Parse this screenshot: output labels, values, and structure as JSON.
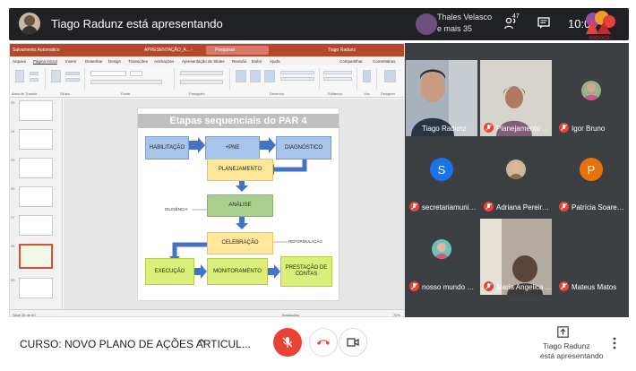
{
  "topbar": {
    "presenting_text": "Tiago Radunz está apresentando",
    "others_name": "Thales Velasco",
    "others_more": "e mais 35",
    "people_count": "47",
    "clock": "10:00",
    "logo_caption": "ARDOCE"
  },
  "ppt": {
    "autosave": "Salvamento Automático",
    "file_name": "APRESENTAÇÃO_A... -",
    "search": "Pesquisar",
    "user": "Tiago Radunz",
    "tabs": [
      "Arquivo",
      "Página Inicial",
      "Inserir",
      "Desenhar",
      "Design",
      "Transições",
      "Animações",
      "Apresentação de Slides",
      "Revisão",
      "Exibir",
      "Ajuda"
    ],
    "share": "Compartilhar",
    "comments": "Comentários",
    "groups": [
      "Área de Transfe...",
      "Slides",
      "Fonte",
      "Parágrafo",
      "Desenho",
      "Editando",
      "Voz",
      "Designer"
    ],
    "thumb_numbers": [
      "23",
      "24",
      "25",
      "26",
      "27",
      "28",
      "29"
    ],
    "status_left": "Slide 28 de 60",
    "status_notes": "Anotações",
    "status_zoom": "72%"
  },
  "slide": {
    "title": "Etapas sequenciais do PAR 4",
    "boxes": {
      "habilitacao": "HABILITAÇÃO",
      "pne": "+PNE",
      "diagnostico": "DIAGNÓSTICO",
      "planejamento": "PLANEJAMENTO",
      "analise": "ANÁLISE",
      "celebracao": "CELEBRAÇÃO",
      "execucao": "EXECUÇÃO",
      "monitoramento": "MONITORAMENTO",
      "prestacao": "PRESTAÇÃO DE CONTAS"
    },
    "labels": {
      "diligencia": "DILIGÊNCIA",
      "reformulacao": "REFORMULAÇÃO"
    }
  },
  "participants": [
    {
      "name": "Tiago Radunz",
      "muted": false
    },
    {
      "name": "Planejamento E...",
      "muted": true
    },
    {
      "name": "Igor Bruno",
      "muted": true
    },
    {
      "name": "secretariamunic...",
      "muted": true,
      "initial": "S",
      "color": "#1a73e8"
    },
    {
      "name": "Adriana Pereira ...",
      "muted": true
    },
    {
      "name": "Patrícia Soares ...",
      "muted": true,
      "initial": "P",
      "color": "#e8710a"
    },
    {
      "name": "nosso mundo M...",
      "muted": true
    },
    {
      "name": "Maria Angelica ...",
      "muted": true
    },
    {
      "name": "Mateus Matos",
      "muted": true
    }
  ],
  "bottombar": {
    "meeting_title": "CURSO: NOVO PLANO DE AÇÕES ARTICUL...",
    "present_line1": "Tiago Radunz",
    "present_line2": "está apresentando"
  },
  "colors": {
    "meet_dark": "#202124",
    "tile_bg": "#3c4043",
    "mute_red": "#ea4335",
    "ppt_red": "#b7472a"
  }
}
